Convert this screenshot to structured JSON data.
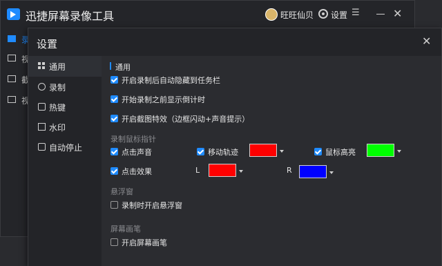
{
  "app": {
    "title": "迅捷屏幕录像工具",
    "username": "旺旺仙贝",
    "settings_label": "设置"
  },
  "left_nav": [
    {
      "label": "录",
      "icon": "video-camera-icon"
    },
    {
      "label": "视",
      "icon": "video-list-icon"
    },
    {
      "label": "截",
      "icon": "crop-icon"
    },
    {
      "label": "视",
      "icon": "settings-icon"
    }
  ],
  "dialog": {
    "title": "设置",
    "sidebar": [
      {
        "label": "通用",
        "icon": "grid-icon",
        "active": true
      },
      {
        "label": "录制",
        "icon": "record-circle-icon"
      },
      {
        "label": "热键",
        "icon": "keyboard-icon"
      },
      {
        "label": "水印",
        "icon": "watermark-icon"
      },
      {
        "label": "自动停止",
        "icon": "pause-icon"
      }
    ],
    "general": {
      "section_title": "通用",
      "options": [
        {
          "label": "开启录制后自动隐藏到任务栏",
          "checked": true
        },
        {
          "label": "开始录制之前显示倒计时",
          "checked": true
        },
        {
          "label": "开启截图特效（边框闪动+声音提示）",
          "checked": true
        }
      ]
    },
    "mouse_pointer": {
      "group_label": "录制鼠标指针",
      "click_sound": {
        "label": "点击声音",
        "checked": true
      },
      "move_trail": {
        "label": "移动轨迹",
        "checked": true,
        "color": "#ff0000"
      },
      "mouse_highlight": {
        "label": "鼠标高亮",
        "checked": true,
        "color": "#00ff00"
      },
      "click_effect": {
        "label": "点击效果",
        "checked": true
      },
      "left_label": "L",
      "left_color": "#ff0000",
      "right_label": "R",
      "right_color": "#0000ff"
    },
    "floating_window": {
      "group_label": "悬浮窗",
      "option": {
        "label": "录制时开启悬浮窗",
        "checked": false
      }
    },
    "screen_pen": {
      "group_label": "屏幕画笔",
      "option": {
        "label": "开启屏幕画笔",
        "checked": false
      }
    }
  },
  "colors": {
    "accent": "#1f8bff"
  }
}
